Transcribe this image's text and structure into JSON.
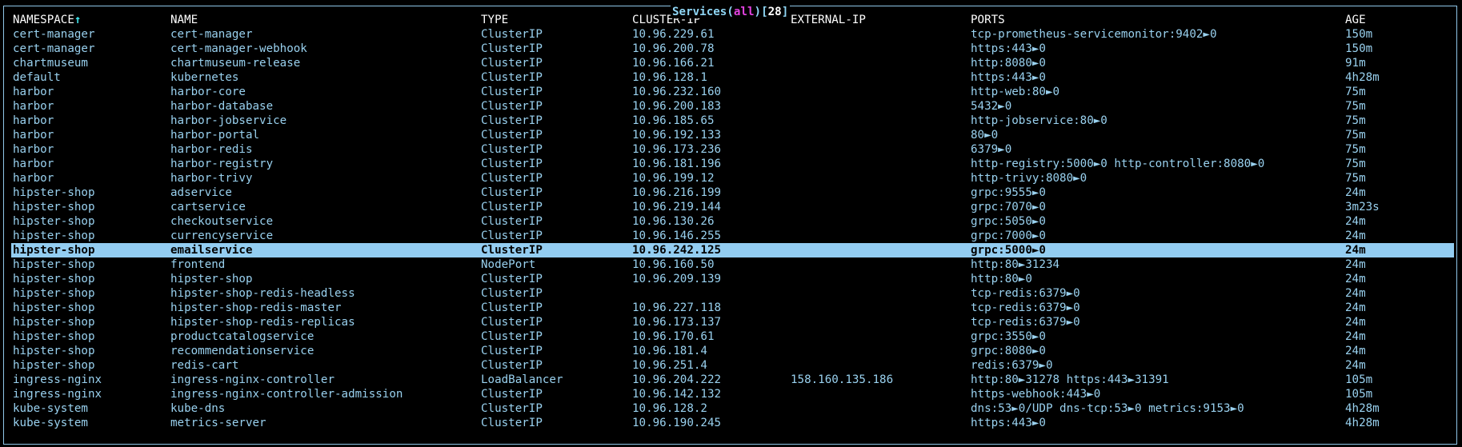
{
  "header": {
    "resource": "Services",
    "filter": "all",
    "count": "28",
    "paren_open": "(",
    "paren_close": ")",
    "bracket_open": "[",
    "bracket_close": "]"
  },
  "columns": {
    "namespace": "NAMESPACE",
    "name": "NAME",
    "type": "TYPE",
    "cluster_ip": "CLUSTER-IP",
    "external_ip": "EXTERNAL-IP",
    "ports": "PORTS",
    "age": "AGE",
    "sort_indicator": "↑"
  },
  "colors": {
    "text": "#99d1ef",
    "header_text": "#ffffff",
    "selection_bg": "#93cdf1",
    "filter_accent": "#e242e0",
    "sort_accent": "#3fe8f0"
  },
  "selected_index": 15,
  "rows": [
    {
      "namespace": "cert-manager",
      "name": "cert-manager",
      "type": "ClusterIP",
      "cluster_ip": "10.96.229.61",
      "external_ip": "",
      "ports": "tcp-prometheus-servicemonitor:9402►0",
      "age": "150m"
    },
    {
      "namespace": "cert-manager",
      "name": "cert-manager-webhook",
      "type": "ClusterIP",
      "cluster_ip": "10.96.200.78",
      "external_ip": "",
      "ports": "https:443►0",
      "age": "150m"
    },
    {
      "namespace": "chartmuseum",
      "name": "chartmuseum-release",
      "type": "ClusterIP",
      "cluster_ip": "10.96.166.21",
      "external_ip": "",
      "ports": "http:8080►0",
      "age": "91m"
    },
    {
      "namespace": "default",
      "name": "kubernetes",
      "type": "ClusterIP",
      "cluster_ip": "10.96.128.1",
      "external_ip": "",
      "ports": "https:443►0",
      "age": "4h28m"
    },
    {
      "namespace": "harbor",
      "name": "harbor-core",
      "type": "ClusterIP",
      "cluster_ip": "10.96.232.160",
      "external_ip": "",
      "ports": "http-web:80►0",
      "age": "75m"
    },
    {
      "namespace": "harbor",
      "name": "harbor-database",
      "type": "ClusterIP",
      "cluster_ip": "10.96.200.183",
      "external_ip": "",
      "ports": "5432►0",
      "age": "75m"
    },
    {
      "namespace": "harbor",
      "name": "harbor-jobservice",
      "type": "ClusterIP",
      "cluster_ip": "10.96.185.65",
      "external_ip": "",
      "ports": "http-jobservice:80►0",
      "age": "75m"
    },
    {
      "namespace": "harbor",
      "name": "harbor-portal",
      "type": "ClusterIP",
      "cluster_ip": "10.96.192.133",
      "external_ip": "",
      "ports": "80►0",
      "age": "75m"
    },
    {
      "namespace": "harbor",
      "name": "harbor-redis",
      "type": "ClusterIP",
      "cluster_ip": "10.96.173.236",
      "external_ip": "",
      "ports": "6379►0",
      "age": "75m"
    },
    {
      "namespace": "harbor",
      "name": "harbor-registry",
      "type": "ClusterIP",
      "cluster_ip": "10.96.181.196",
      "external_ip": "",
      "ports": "http-registry:5000►0 http-controller:8080►0",
      "age": "75m"
    },
    {
      "namespace": "harbor",
      "name": "harbor-trivy",
      "type": "ClusterIP",
      "cluster_ip": "10.96.199.12",
      "external_ip": "",
      "ports": "http-trivy:8080►0",
      "age": "75m"
    },
    {
      "namespace": "hipster-shop",
      "name": "adservice",
      "type": "ClusterIP",
      "cluster_ip": "10.96.216.199",
      "external_ip": "",
      "ports": "grpc:9555►0",
      "age": "24m"
    },
    {
      "namespace": "hipster-shop",
      "name": "cartservice",
      "type": "ClusterIP",
      "cluster_ip": "10.96.219.144",
      "external_ip": "",
      "ports": "grpc:7070►0",
      "age": "3m23s"
    },
    {
      "namespace": "hipster-shop",
      "name": "checkoutservice",
      "type": "ClusterIP",
      "cluster_ip": "10.96.130.26",
      "external_ip": "",
      "ports": "grpc:5050►0",
      "age": "24m"
    },
    {
      "namespace": "hipster-shop",
      "name": "currencyservice",
      "type": "ClusterIP",
      "cluster_ip": "10.96.146.255",
      "external_ip": "",
      "ports": "grpc:7000►0",
      "age": "24m"
    },
    {
      "namespace": "hipster-shop",
      "name": "emailservice",
      "type": "ClusterIP",
      "cluster_ip": "10.96.242.125",
      "external_ip": "",
      "ports": "grpc:5000►0",
      "age": "24m"
    },
    {
      "namespace": "hipster-shop",
      "name": "frontend",
      "type": "NodePort",
      "cluster_ip": "10.96.160.50",
      "external_ip": "",
      "ports": "http:80►31234",
      "age": "24m"
    },
    {
      "namespace": "hipster-shop",
      "name": "hipster-shop",
      "type": "ClusterIP",
      "cluster_ip": "10.96.209.139",
      "external_ip": "",
      "ports": "http:80►0",
      "age": "24m"
    },
    {
      "namespace": "hipster-shop",
      "name": "hipster-shop-redis-headless",
      "type": "ClusterIP",
      "cluster_ip": "",
      "external_ip": "",
      "ports": "tcp-redis:6379►0",
      "age": "24m"
    },
    {
      "namespace": "hipster-shop",
      "name": "hipster-shop-redis-master",
      "type": "ClusterIP",
      "cluster_ip": "10.96.227.118",
      "external_ip": "",
      "ports": "tcp-redis:6379►0",
      "age": "24m"
    },
    {
      "namespace": "hipster-shop",
      "name": "hipster-shop-redis-replicas",
      "type": "ClusterIP",
      "cluster_ip": "10.96.173.137",
      "external_ip": "",
      "ports": "tcp-redis:6379►0",
      "age": "24m"
    },
    {
      "namespace": "hipster-shop",
      "name": "productcatalogservice",
      "type": "ClusterIP",
      "cluster_ip": "10.96.170.61",
      "external_ip": "",
      "ports": "grpc:3550►0",
      "age": "24m"
    },
    {
      "namespace": "hipster-shop",
      "name": "recommendationservice",
      "type": "ClusterIP",
      "cluster_ip": "10.96.181.4",
      "external_ip": "",
      "ports": "grpc:8080►0",
      "age": "24m"
    },
    {
      "namespace": "hipster-shop",
      "name": "redis-cart",
      "type": "ClusterIP",
      "cluster_ip": "10.96.251.4",
      "external_ip": "",
      "ports": "redis:6379►0",
      "age": "24m"
    },
    {
      "namespace": "ingress-nginx",
      "name": "ingress-nginx-controller",
      "type": "LoadBalancer",
      "cluster_ip": "10.96.204.222",
      "external_ip": "158.160.135.186",
      "ports": "http:80►31278 https:443►31391",
      "age": "105m"
    },
    {
      "namespace": "ingress-nginx",
      "name": "ingress-nginx-controller-admission",
      "type": "ClusterIP",
      "cluster_ip": "10.96.142.132",
      "external_ip": "",
      "ports": "https-webhook:443►0",
      "age": "105m"
    },
    {
      "namespace": "kube-system",
      "name": "kube-dns",
      "type": "ClusterIP",
      "cluster_ip": "10.96.128.2",
      "external_ip": "",
      "ports": "dns:53►0/UDP dns-tcp:53►0 metrics:9153►0",
      "age": "4h28m"
    },
    {
      "namespace": "kube-system",
      "name": "metrics-server",
      "type": "ClusterIP",
      "cluster_ip": "10.96.190.245",
      "external_ip": "",
      "ports": "https:443►0",
      "age": "4h28m"
    }
  ]
}
